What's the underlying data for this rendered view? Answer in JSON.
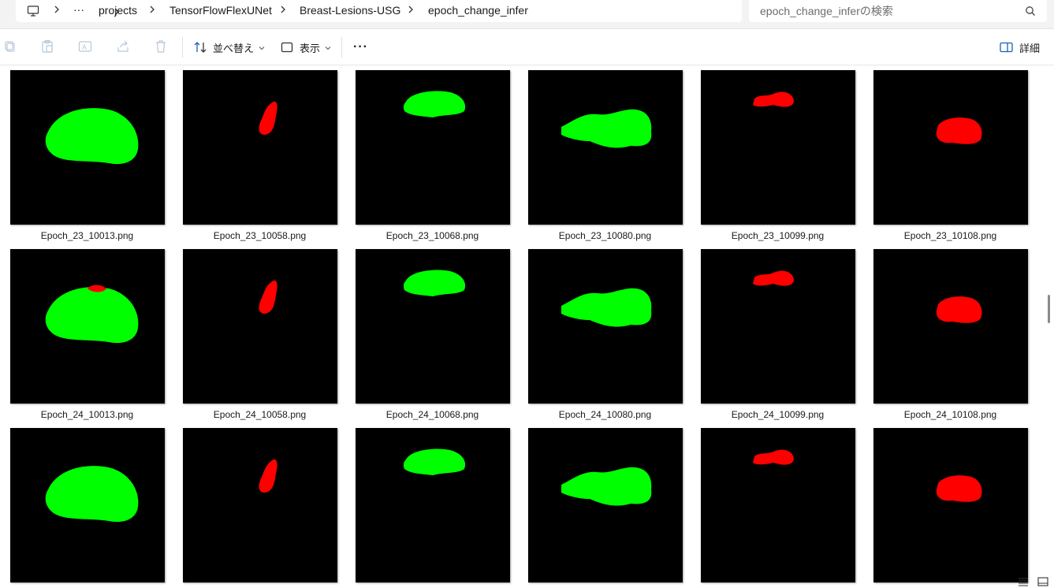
{
  "address_bar": {
    "overflow_label": "···",
    "crumbs": [
      "projects",
      "TensorFlowFlexUNet",
      "Breast-Lesions-USG",
      "epoch_change_infer"
    ],
    "separator": ">"
  },
  "search": {
    "placeholder": "epoch_change_inferの検索"
  },
  "toolbar": {
    "sort_label": "並べ替え",
    "view_label": "表示",
    "more_label": "···",
    "details_label": "詳細"
  },
  "colors": {
    "green": "#00ff00",
    "red": "#ff0000",
    "tile_bg": "#000000"
  },
  "files": [
    {
      "name": "Epoch_23_10013.png",
      "color": "green"
    },
    {
      "name": "Epoch_23_10058.png",
      "color": "red"
    },
    {
      "name": "Epoch_23_10068.png",
      "color": "green"
    },
    {
      "name": "Epoch_23_10080.png",
      "color": "green"
    },
    {
      "name": "Epoch_23_10099.png",
      "color": "red"
    },
    {
      "name": "Epoch_23_10108.png",
      "color": "red"
    },
    {
      "name": "Epoch_24_10013.png",
      "color": "green"
    },
    {
      "name": "Epoch_24_10058.png",
      "color": "red"
    },
    {
      "name": "Epoch_24_10068.png",
      "color": "green"
    },
    {
      "name": "Epoch_24_10080.png",
      "color": "green"
    },
    {
      "name": "Epoch_24_10099.png",
      "color": "red"
    },
    {
      "name": "Epoch_24_10108.png",
      "color": "red"
    },
    {
      "name": "",
      "color": "green"
    },
    {
      "name": "",
      "color": "red"
    },
    {
      "name": "",
      "color": "green"
    },
    {
      "name": "",
      "color": "green"
    },
    {
      "name": "",
      "color": "red"
    },
    {
      "name": "",
      "color": "red"
    }
  ]
}
